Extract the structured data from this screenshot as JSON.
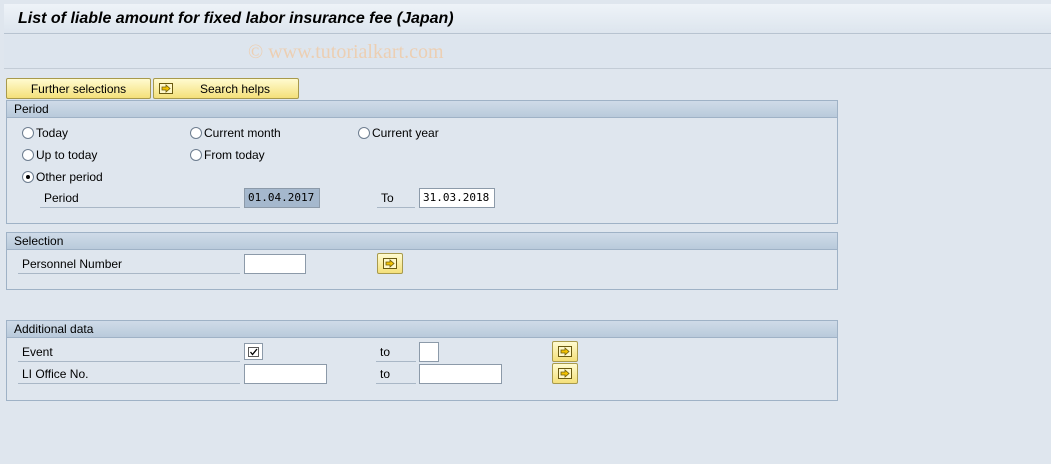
{
  "title": "List of liable amount for fixed labor insurance fee (Japan)",
  "watermark": "© www.tutorialkart.com",
  "buttons": {
    "further_selections": "Further selections",
    "search_helps": "Search helps"
  },
  "period": {
    "header": "Period",
    "options": {
      "today": "Today",
      "current_month": "Current month",
      "current_year": "Current year",
      "up_to_today": "Up to today",
      "from_today": "From today",
      "other_period": "Other period"
    },
    "selected": "other_period",
    "period_label": "Period",
    "from_value": "01.04.2017",
    "to_label": "To",
    "to_value": "31.03.2018"
  },
  "selection": {
    "header": "Selection",
    "personnel_number_label": "Personnel Number",
    "personnel_number_value": ""
  },
  "additional": {
    "header": "Additional data",
    "event_label": "Event",
    "event_checked": true,
    "event_to_label": "to",
    "event_to_value": "",
    "li_office_label": "LI Office No.",
    "li_office_value": "",
    "li_office_to_label": "to",
    "li_office_to_value": ""
  },
  "colors": {
    "background": "#dfe6ee",
    "button_yellow": "#f4e07a",
    "group_header": "#c4d3e2"
  }
}
